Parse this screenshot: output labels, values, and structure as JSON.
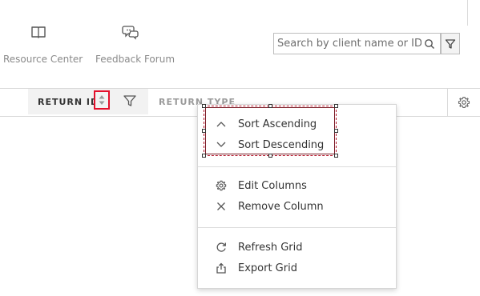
{
  "nav": {
    "resource_center": {
      "label": "Resource Center",
      "icon": "book-icon"
    },
    "feedback_forum": {
      "label": "Feedback Forum",
      "icon": "chat-bubbles-icon"
    }
  },
  "search": {
    "placeholder": "Search by client name or ID",
    "value": "",
    "icon": "search-icon"
  },
  "grid": {
    "columns": [
      {
        "label": "RETURN ID",
        "color": "#333333"
      },
      {
        "label": "RETURN TYPE",
        "color": "#9a9a9a"
      }
    ]
  },
  "menu": {
    "sort_group": [
      {
        "label": "Sort Ascending",
        "icon": "chevron-up-icon"
      },
      {
        "label": "Sort Descending",
        "icon": "chevron-down-icon"
      }
    ],
    "column_group": [
      {
        "label": "Edit Columns",
        "icon": "gear-icon"
      },
      {
        "label": "Remove Column",
        "icon": "close-icon"
      }
    ],
    "grid_group": [
      {
        "label": "Refresh Grid",
        "icon": "refresh-icon"
      },
      {
        "label": "Export Grid",
        "icon": "export-icon"
      }
    ]
  },
  "colors": {
    "highlight_red": "#e3102b",
    "selection_box": "#b5182c",
    "icon_gray": "#555555"
  }
}
